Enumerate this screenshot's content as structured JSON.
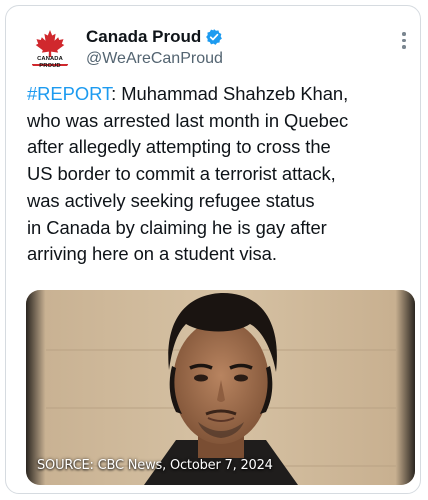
{
  "tweet": {
    "author": {
      "name": "Canada Proud",
      "handle": "@WeAreCanProud",
      "avatar_text": "CANADA PROUD",
      "verified": true,
      "verified_icon": "verified-badge-icon"
    },
    "more_icon": "more-options-icon",
    "text": {
      "hashtag": "#REPORT",
      "line1_rest": ": Muhammad Shahzeb Khan,",
      "lines": [
        "who was arrested last month in Quebec",
        "after allegedly attempting to cross the",
        "US border to commit a terrorist attack,",
        "was actively seeking refugee status",
        "in Canada by claiming he is gay after",
        "arriving here on a student visa."
      ]
    },
    "media": {
      "caption": "SOURCE: CBC News, October 7, 2024"
    }
  },
  "colors": {
    "accent": "#1d9bf0",
    "brand_red": "#d0282d",
    "text": "#0f1419",
    "muted": "#536471",
    "border": "#d6dbe0"
  }
}
